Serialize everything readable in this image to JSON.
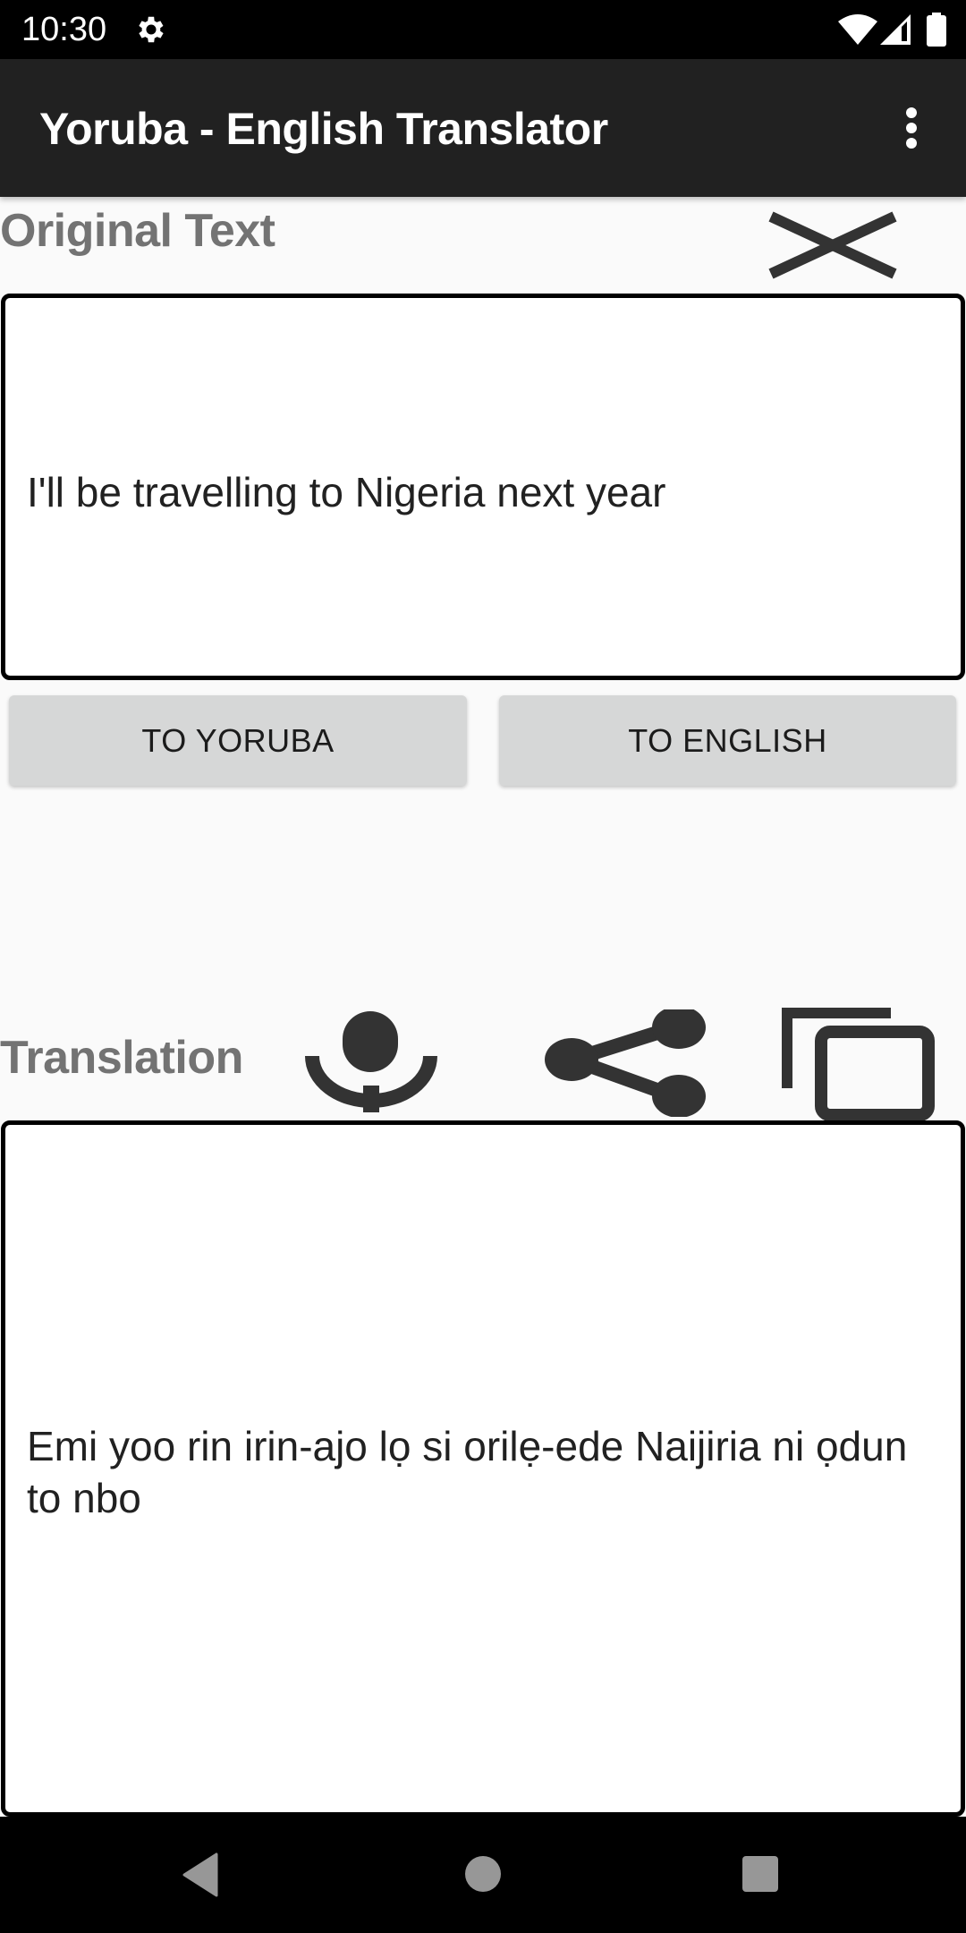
{
  "status_bar": {
    "time": "10:30",
    "icons": [
      "settings-gear",
      "wifi-full",
      "cell-signal-partial",
      "battery-full"
    ]
  },
  "app_bar": {
    "title": "Yoruba - English Translator",
    "overflow_icon": "more-vert"
  },
  "original": {
    "label": "Original Text",
    "clear_icon": "close",
    "text": "I'll be travelling to Nigeria next year"
  },
  "actions": {
    "to_yoruba_label": "TO YORUBA",
    "to_english_label": "TO ENGLISH"
  },
  "translation": {
    "label": "Translation",
    "icons": [
      "microphone",
      "share",
      "copy"
    ],
    "text": "Emi yoo rin irin-ajo lọ si orilẹ-ede Naijiria ni ọdun to nbo"
  },
  "nav_bar": {
    "icons": [
      "back",
      "home",
      "recents"
    ]
  },
  "colors": {
    "app_bar": "#212121",
    "status_bar": "#000000",
    "label_gray": "#737373",
    "button_gray": "#d6d7d7",
    "icon_dark": "#333333"
  }
}
